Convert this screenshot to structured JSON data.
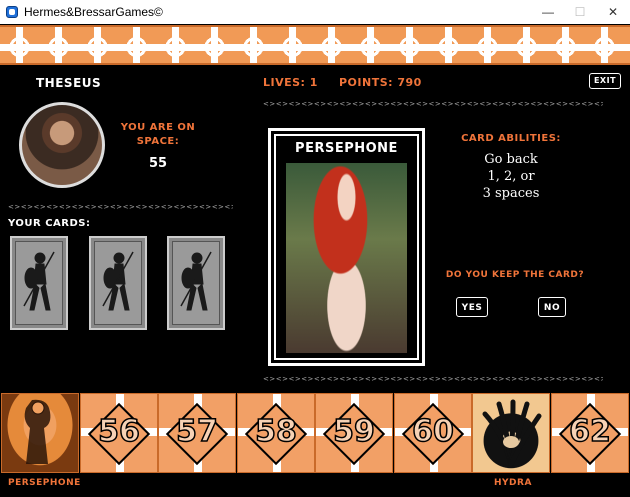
{
  "window": {
    "title": "Hermes&BressarGames©",
    "controls": [
      "—",
      "☐",
      "✕"
    ]
  },
  "player": {
    "name": "Theseus",
    "space_label": "You are on space:",
    "space_number": "55"
  },
  "stats": {
    "lives": "Lives: 1",
    "points": "Points: 790"
  },
  "exit_label": "Exit",
  "your_cards_label": "Your cards:",
  "hand_cards": [
    {
      "icon": "spartan-warrior-icon"
    },
    {
      "icon": "spartan-warrior-icon"
    },
    {
      "icon": "spartan-warrior-icon"
    }
  ],
  "drawn_card": {
    "name": "PERSEPHONE"
  },
  "abilities": {
    "title": "Card abilities:",
    "line1": "Go back",
    "line2": "1, 2, or",
    "line3": "3 spaces"
  },
  "keep_prompt": "Do you keep the card?",
  "buttons": {
    "yes": "Yes",
    "no": "No"
  },
  "dashes": "<><><><><><><><><><><><><><><><><><><><><><><><><><><><><><><><><><><><><><><>",
  "board": {
    "tiles": [
      {
        "type": "special",
        "label": "PERSEPHONE"
      },
      {
        "type": "number",
        "number": "56"
      },
      {
        "type": "number",
        "number": "57"
      },
      {
        "type": "number",
        "number": "58"
      },
      {
        "type": "number",
        "number": "59"
      },
      {
        "type": "number",
        "number": "60"
      },
      {
        "type": "special",
        "label": "HYDRA"
      },
      {
        "type": "number",
        "number": "62"
      }
    ]
  },
  "colors": {
    "accent": "#f0743a",
    "tile": "#f2a066",
    "background": "#000000"
  }
}
